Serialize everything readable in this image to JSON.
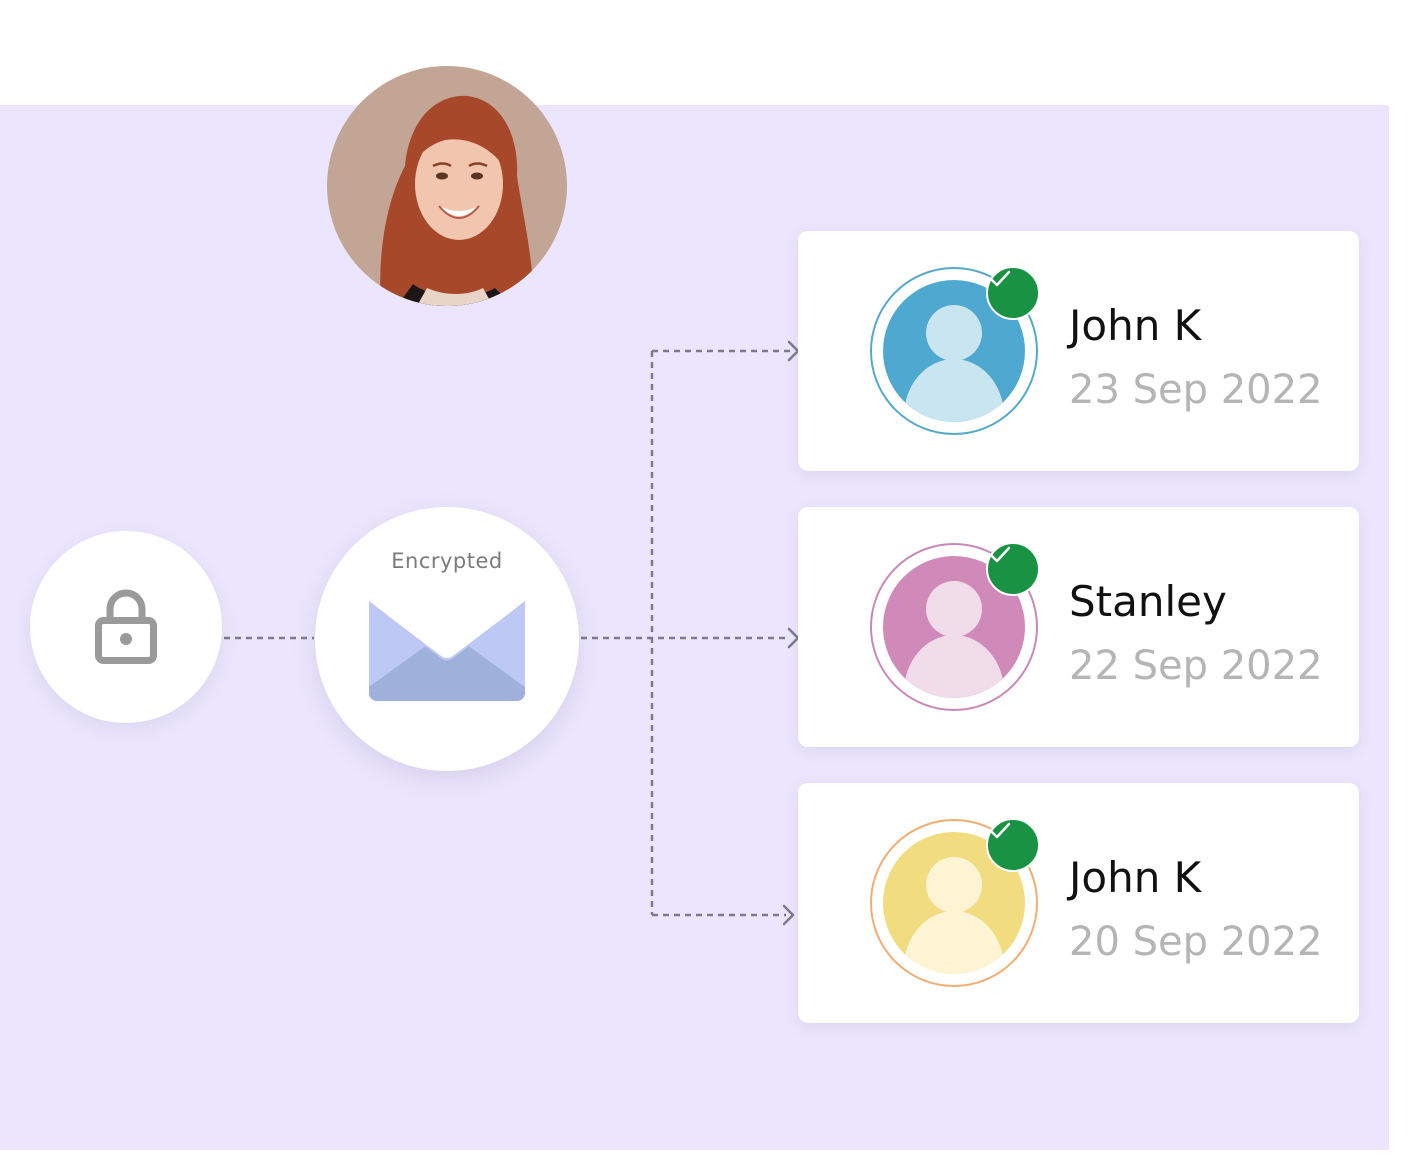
{
  "sender": {
    "photo_icon": "sender-photo"
  },
  "lock": {
    "icon": "lock-icon"
  },
  "mail": {
    "label": "Encrypted",
    "icon": "envelope-icon"
  },
  "recipients": [
    {
      "name": "John K",
      "date": "23 Sep 2022",
      "color": "#4fa8cf",
      "ring_color": "#55a9c8",
      "light_color": "#c9e5f0",
      "status": "check-icon"
    },
    {
      "name": "Stanley",
      "date": "22 Sep 2022",
      "color": "#d08ab9",
      "ring_color": "#c989b6",
      "light_color": "#f1dcea",
      "status": "check-icon"
    },
    {
      "name": "John K",
      "date": "20 Sep 2022",
      "color": "#f1dd7f",
      "ring_color": "#f2ad73",
      "light_color": "#fdf4d3",
      "status": "check-icon"
    }
  ],
  "colors": {
    "background": "#ebe6fd",
    "connector": "#7d7a8c",
    "check": "#199244"
  }
}
